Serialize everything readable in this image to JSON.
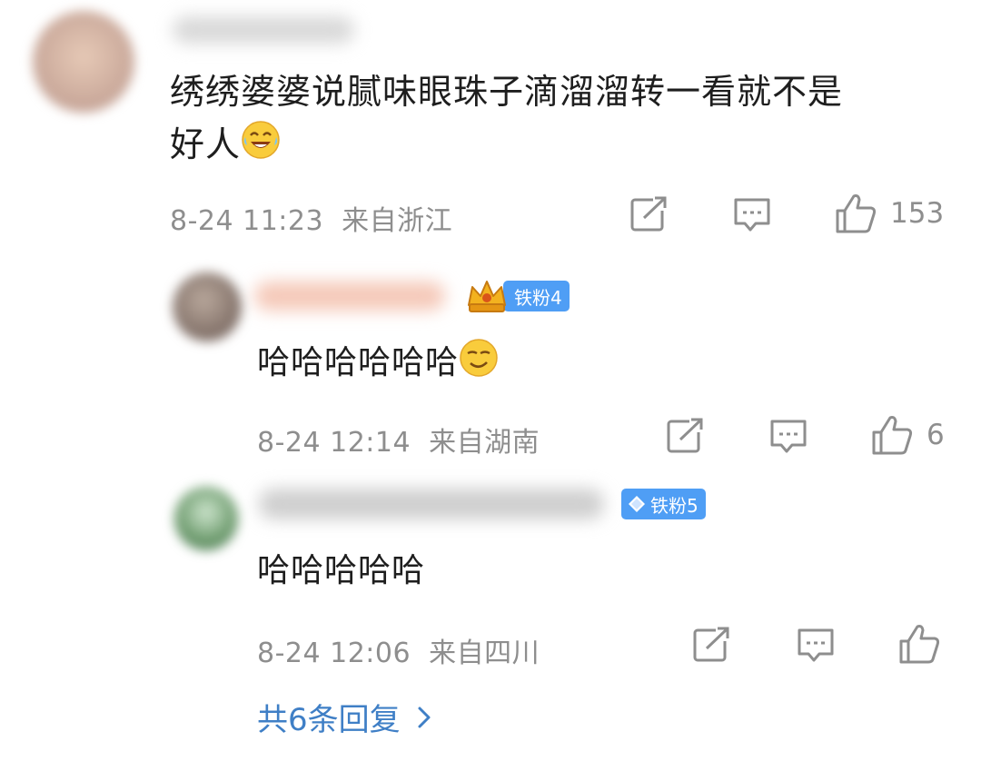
{
  "comments": [
    {
      "text_line1": "绣绣婆婆说腻味眼珠子滴溜溜转一看就不是",
      "text_line2": "好人",
      "emoji": "laughing-tears-emoji",
      "time": "8-24 11:23",
      "location": "来自浙江",
      "likes": "153"
    }
  ],
  "replies": [
    {
      "badge": "铁粉4",
      "badge_icon": "crown-icon",
      "text": "哈哈哈哈哈哈",
      "emoji": "smirk-emoji",
      "time": "8-24 12:14",
      "location": "来自湖南",
      "likes": "6"
    },
    {
      "badge": "铁粉5",
      "badge_icon": "diamond-icon",
      "text": "哈哈哈哈哈",
      "time": "8-24 12:06",
      "location": "来自四川",
      "likes": ""
    }
  ],
  "more_replies": "共6条回复",
  "colors": {
    "meta": "#8e8e8e",
    "badge": "#4f9ef5",
    "link": "#3f7fc6"
  }
}
